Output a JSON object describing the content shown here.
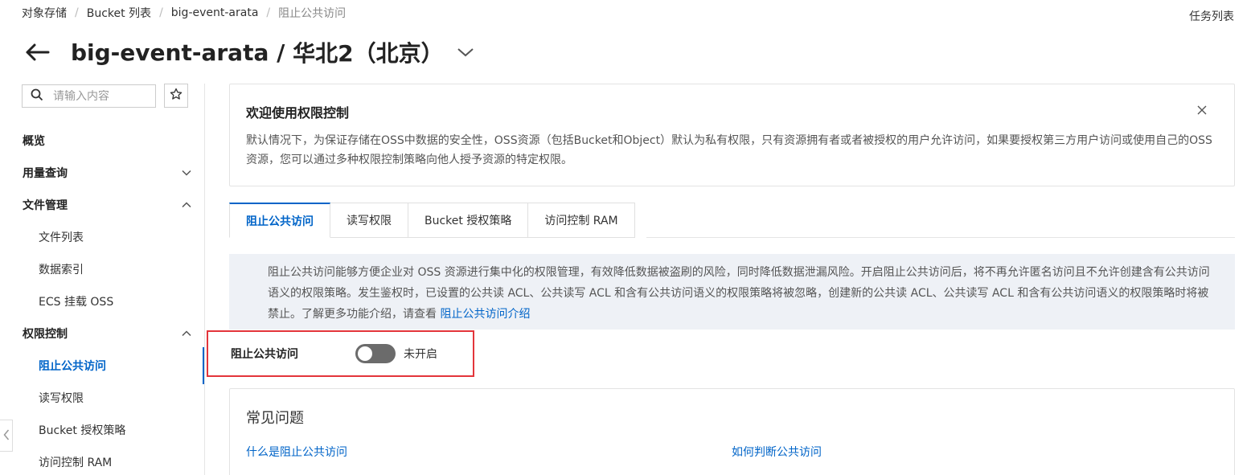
{
  "breadcrumb": [
    "对象存储",
    "Bucket 列表",
    "big-event-arata",
    "阻止公共访问"
  ],
  "task_list_label": "任务列表",
  "header": {
    "bucket_name": "big-event-arata",
    "separator": " / ",
    "region": "华北2（北京）"
  },
  "sidebar": {
    "search_placeholder": "请输入内容",
    "items": [
      {
        "label": "概览",
        "type": "group"
      },
      {
        "label": "用量查询",
        "type": "group",
        "chevron": "down"
      },
      {
        "label": "文件管理",
        "type": "group",
        "chevron": "up"
      },
      {
        "label": "文件列表",
        "type": "sub"
      },
      {
        "label": "数据索引",
        "type": "sub"
      },
      {
        "label": "ECS 挂载 OSS",
        "type": "sub"
      },
      {
        "label": "权限控制",
        "type": "group",
        "chevron": "up"
      },
      {
        "label": "阻止公共访问",
        "type": "sub",
        "active": true
      },
      {
        "label": "读写权限",
        "type": "sub"
      },
      {
        "label": "Bucket 授权策略",
        "type": "sub"
      },
      {
        "label": "访问控制 RAM",
        "type": "sub"
      }
    ]
  },
  "welcome": {
    "title": "欢迎使用权限控制",
    "text": "默认情况下，为保证存储在OSS中数据的安全性，OSS资源（包括Bucket和Object）默认为私有权限，只有资源拥有者或者被授权的用户允许访问，如果要授权第三方用户访问或使用自己的OSS资源，您可以通过多种权限控制策略向他人授予资源的特定权限。"
  },
  "tabs": [
    "阻止公共访问",
    "读写权限",
    "Bucket 授权策略",
    "访问控制 RAM"
  ],
  "notice": {
    "text": "阻止公共访问能够方便企业对 OSS 资源进行集中化的权限管理，有效降低数据被盗刷的风险，同时降低数据泄漏风险。开启阻止公共访问后，将不再允许匿名访问且不允许创建含有公共访问语义的权限策略。发生鉴权时，已设置的公共读 ACL、公共读写 ACL 和含有公共访问语义的权限策略将被忽略，创建新的公共读 ACL、公共读写 ACL 和含有公共访问语义的权限策略时将被禁止。了解更多功能介绍，请查看 ",
    "link": "阻止公共访问介绍"
  },
  "block_public_access": {
    "label": "阻止公共访问",
    "enabled": false,
    "status": "未开启"
  },
  "faq": {
    "title": "常见问题",
    "links": [
      "什么是阻止公共访问",
      "如何判断公共访问"
    ]
  },
  "colors": {
    "accent": "#0064c8",
    "highlight_border": "#e3353b",
    "toggle_off": "#6b6b6b",
    "notice_bg": "#eef1f6"
  }
}
